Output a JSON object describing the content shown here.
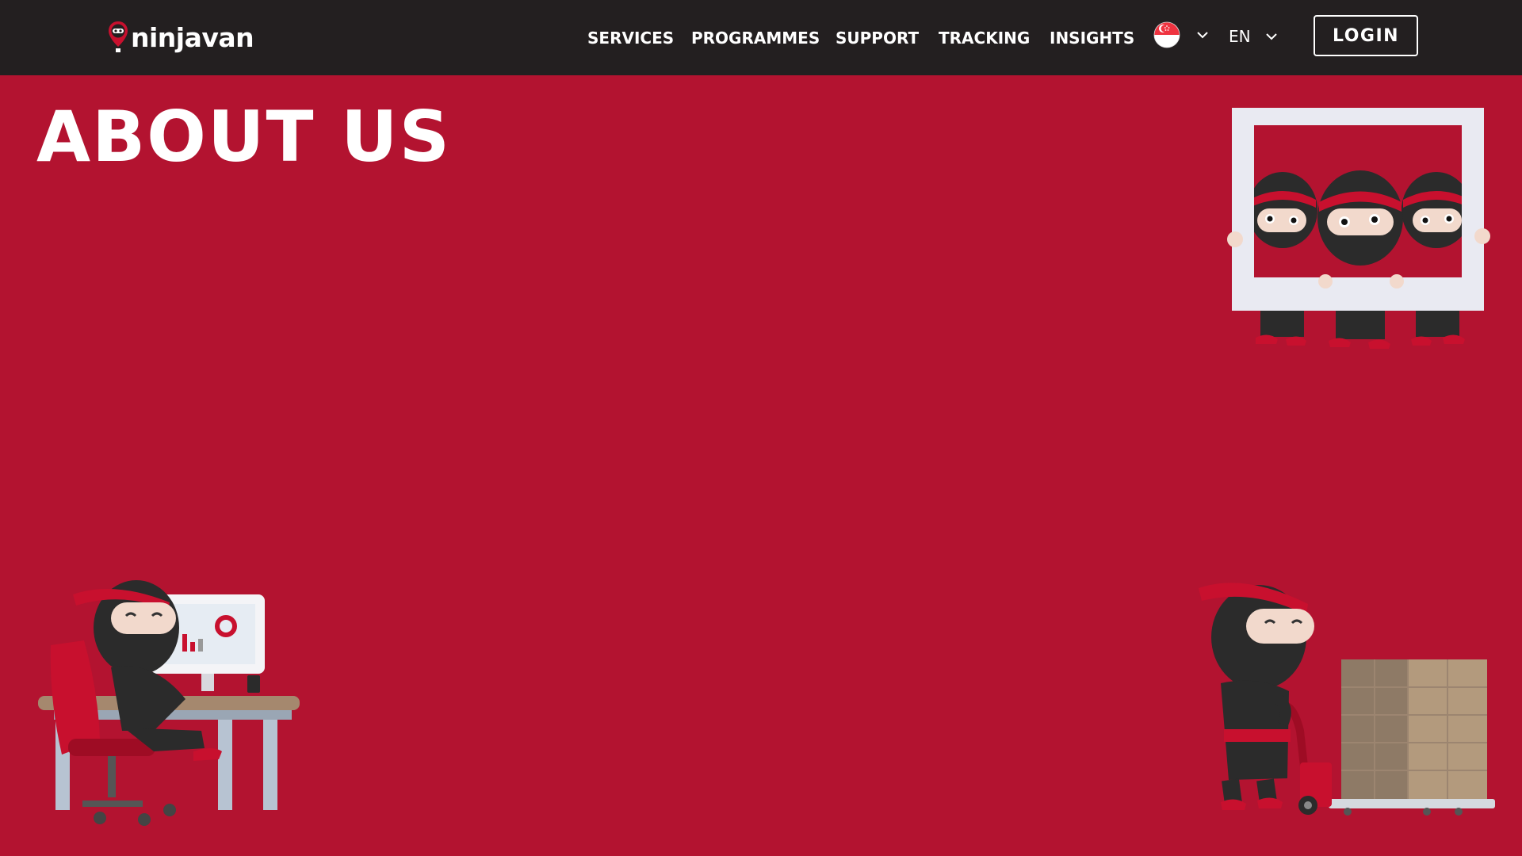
{
  "nav": {
    "brand": "ninjavan",
    "menu": [
      {
        "label": "SERVICES"
      },
      {
        "label": "PROGRAMMES"
      },
      {
        "label": "SUPPORT"
      },
      {
        "label": "TRACKING"
      },
      {
        "label": "INSIGHTS"
      }
    ],
    "country_flag": "singapore-flag-icon",
    "language": "EN",
    "login_label": "LOGIN"
  },
  "hero": {
    "title": "ABOUT US"
  },
  "colors": {
    "brand_red": "#B31330",
    "nav_bg": "#231F20",
    "text": "#FFFFFF"
  },
  "illustrations": [
    "ninjas-holding-frame",
    "ninja-at-desk-computer",
    "ninja-pushing-pallet-of-boxes"
  ]
}
